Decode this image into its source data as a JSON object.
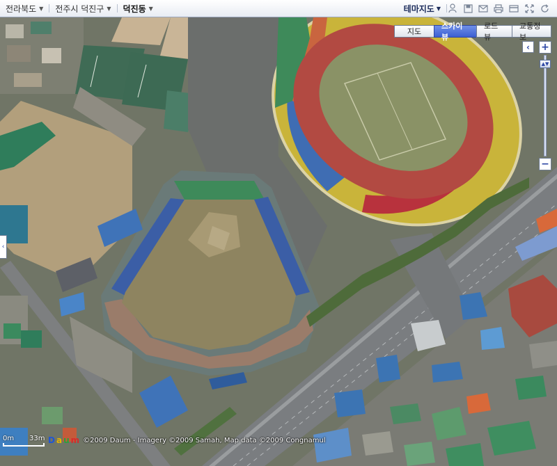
{
  "breadcrumb": {
    "province": "전라북도",
    "city": "전주시 덕진구",
    "district": "덕진동"
  },
  "theme_menu_label": "테마지도",
  "toolbar_icons": [
    "person-icon",
    "save-icon",
    "mail-icon",
    "print-icon",
    "card-icon",
    "expand-icon",
    "refresh-icon"
  ],
  "map_types": [
    {
      "label": "지도",
      "active": false
    },
    {
      "label": "스카이뷰",
      "active": true
    },
    {
      "label": "로드뷰",
      "active": false
    },
    {
      "label": "교통정보",
      "active": false
    }
  ],
  "zoom": {
    "in_label": "+",
    "out_label": "−",
    "level_fraction": 0.05
  },
  "scale": {
    "zero_label": "0m",
    "distance_label": "33m"
  },
  "logo": {
    "text": "Daum",
    "colors": [
      "#1f56d6",
      "#e8b400",
      "#2aa13c",
      "#d62b2b"
    ]
  },
  "copyright": "©2009 Daum - Imagery ©2009 Samah, Map data ©2009 Congnamul",
  "colors": {
    "active_tab": "#3c5fd3",
    "track_red": "#b24a42",
    "track_inner": "#a04a48",
    "pitch": "#8a9266",
    "seats_blue": "#3f6db3",
    "seats_yellow": "#c9b43a",
    "seats_red": "#b8323d",
    "seats_green": "#3e8a5a",
    "dirt": "#b89f7a",
    "road": "#7a7d80"
  }
}
